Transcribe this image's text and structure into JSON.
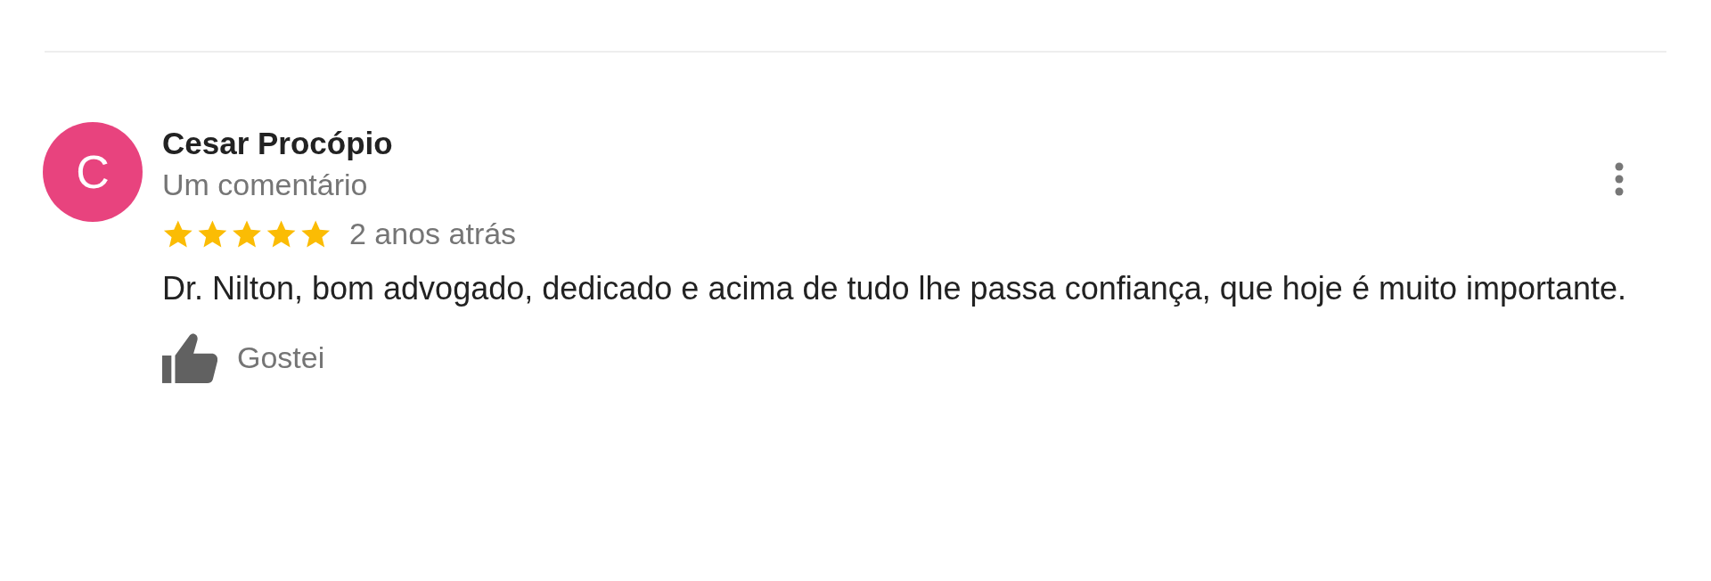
{
  "review": {
    "avatar": {
      "letter": "C",
      "color": "#e8437e"
    },
    "author": "Cesar Procópio",
    "subtitle": "Um comentário",
    "stars": 5,
    "time": "2 anos atrás",
    "text": "Dr. Nilton, bom advogado, dedicado e acima de tudo lhe passa confiança, que hoje é muito importante.",
    "like": {
      "label": "Gostei"
    }
  }
}
